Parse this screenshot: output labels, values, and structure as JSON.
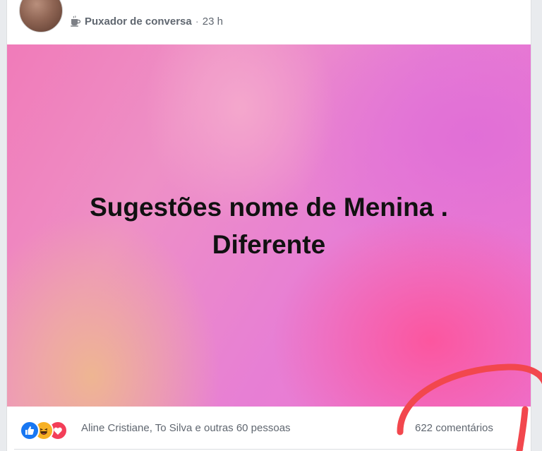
{
  "post": {
    "group_name": "Puxador de conversa",
    "separator": "·",
    "time": "23 h",
    "background_text_line1": "Sugestões nome de Menina .",
    "background_text_line2": "Diferente"
  },
  "reactions": {
    "types": [
      "like",
      "haha",
      "love"
    ],
    "reactors_text": "Aline Cristiane, To Silva e outras 60 pessoas",
    "comments_text": "622 comentários"
  },
  "colors": {
    "like": "#1877f2",
    "haha": "#f7b125",
    "love": "#f33e58",
    "annotation": "#f2474d",
    "meta_text": "#606770"
  },
  "icons": {
    "group_type": "coffee-cup-icon",
    "reaction_like": "thumbs-up-icon",
    "reaction_haha": "laughing-face-icon",
    "reaction_love": "heart-icon"
  }
}
